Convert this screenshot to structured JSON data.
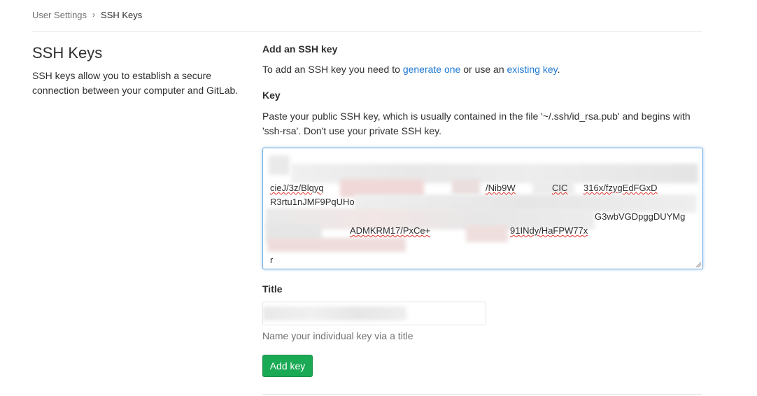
{
  "breadcrumb": {
    "parent": "User Settings",
    "separator": "›",
    "current": "SSH Keys"
  },
  "sidebar": {
    "title": "SSH Keys",
    "description": "SSH keys allow you to establish a secure connection between your computer and GitLab."
  },
  "add_section": {
    "heading": "Add an SSH key",
    "intro_prefix": "To add an SSH key you need to ",
    "link_generate": "generate one",
    "intro_middle": " or use an ",
    "link_existing": "existing key",
    "intro_suffix": "."
  },
  "key_field": {
    "label": "Key",
    "help": "Paste your public SSH key, which is usually contained in the file '~/.ssh/id_rsa.pub' and begins with 'ssh-rsa'. Don't use your private SSH key.",
    "visible_fragments": {
      "line2_a": "cieJ/3z/Blqyq",
      "line2_b": "/Nib9W",
      "line2_c": "CIC",
      "line2_d": "316x/fzygEdFGxD",
      "line3_a": "R3rtu1nJMF9PqUHo",
      "line4_end": "G3wbVGDpggDUYMg",
      "line5_a": "ADMKRM17/PxCe+",
      "line5_b": "91INdy/HaFPW77x",
      "line6": "r"
    }
  },
  "title_field": {
    "label": "Title",
    "help": "Name your individual key via a title"
  },
  "submit": {
    "label": "Add key"
  },
  "colors": {
    "link": "#1f78d1",
    "button_bg": "#1aaa55",
    "button_border": "#168f48",
    "focus_border": "#73afea",
    "divider": "#e5e5e5",
    "muted_text": "#707070"
  }
}
